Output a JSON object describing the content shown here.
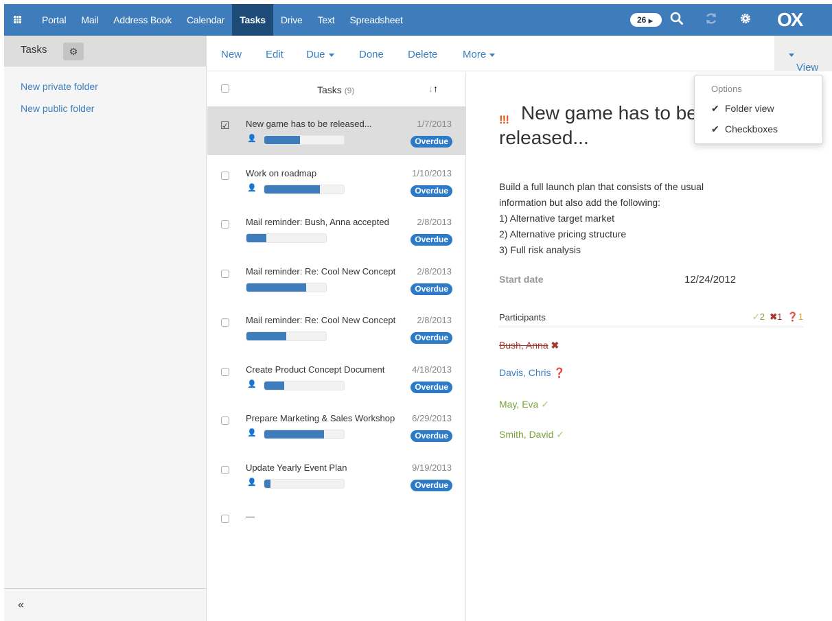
{
  "topbar": {
    "nav": [
      "Portal",
      "Mail",
      "Address Book",
      "Calendar",
      "Tasks",
      "Drive",
      "Text",
      "Spreadsheet"
    ],
    "active": "Tasks",
    "badge": "26",
    "logo": "OX",
    "icons": [
      "apps-grid-icon",
      "search-icon",
      "refresh-icon",
      "gear-icon"
    ]
  },
  "sidebar": {
    "title": "Tasks",
    "links": [
      "New private folder",
      "New public folder"
    ],
    "collapse": "«"
  },
  "toolbar": {
    "new": "New",
    "edit": "Edit",
    "due": "Due",
    "done": "Done",
    "delete": "Delete",
    "more": "More",
    "view": "View"
  },
  "list": {
    "title": "Tasks",
    "count": "(9)",
    "rows": [
      {
        "title": "New game has to be released...",
        "date": "1/7/2013",
        "badge": "Overdue",
        "progress": 0.45,
        "has_person": true,
        "selected": true
      },
      {
        "title": "Work on roadmap",
        "date": "1/10/2013",
        "badge": "Overdue",
        "progress": 0.7,
        "has_person": true,
        "selected": false
      },
      {
        "title": "Mail reminder: Bush, Anna accepted",
        "date": "2/8/2013",
        "badge": "Overdue",
        "progress": 0.25,
        "has_person": false,
        "selected": false
      },
      {
        "title": "Mail reminder: Re: Cool New Concept",
        "date": "2/8/2013",
        "badge": "Overdue",
        "progress": 0.75,
        "has_person": false,
        "selected": false
      },
      {
        "title": "Mail reminder: Re: Cool New Concept",
        "date": "2/8/2013",
        "badge": "Overdue",
        "progress": 0.5,
        "has_person": false,
        "selected": false
      },
      {
        "title": "Create Product Concept Document",
        "date": "4/18/2013",
        "badge": "Overdue",
        "progress": 0.25,
        "has_person": true,
        "selected": false
      },
      {
        "title": "Prepare Marketing & Sales Workshop",
        "date": "6/29/2013",
        "badge": "Overdue",
        "progress": 0.75,
        "has_person": true,
        "selected": false
      },
      {
        "title": "Update Yearly Event Plan",
        "date": "9/19/2013",
        "badge": "Overdue",
        "progress": 0.08,
        "has_person": true,
        "selected": false
      },
      {
        "title": "—",
        "date": "",
        "badge": "",
        "progress": null,
        "has_person": false,
        "selected": false
      }
    ]
  },
  "detail": {
    "priority": "!!!",
    "title": "New game has to be released...",
    "description": [
      "Build a full launch plan that consists of the usual",
      "information but also add the following:",
      "1) Alternative target market",
      "2) Alternative pricing structure",
      "3) Full risk analysis"
    ],
    "start_date_label": "Start date",
    "start_date_value": "12/24/2012",
    "participants_label": "Participants",
    "counts": {
      "accepted": "2",
      "declined": "1",
      "tentative": "1"
    },
    "participants": [
      {
        "name": "Bush, Anna",
        "status": "declined"
      },
      {
        "name": "Davis, Chris",
        "status": "tentative"
      },
      {
        "name": "May, Eva",
        "status": "accepted"
      },
      {
        "name": "Smith, David",
        "status": "accepted"
      }
    ]
  },
  "view_menu": {
    "header": "Options",
    "items": [
      {
        "label": "Folder view",
        "checked": true
      },
      {
        "label": "Checkboxes",
        "checked": true
      }
    ]
  },
  "colors": {
    "topbar": "#3f7cbc",
    "active_tab": "#1e4a78",
    "link": "#3a7fc1",
    "overdue_badge": "#2d7bc6",
    "priority": "#e8531b"
  }
}
